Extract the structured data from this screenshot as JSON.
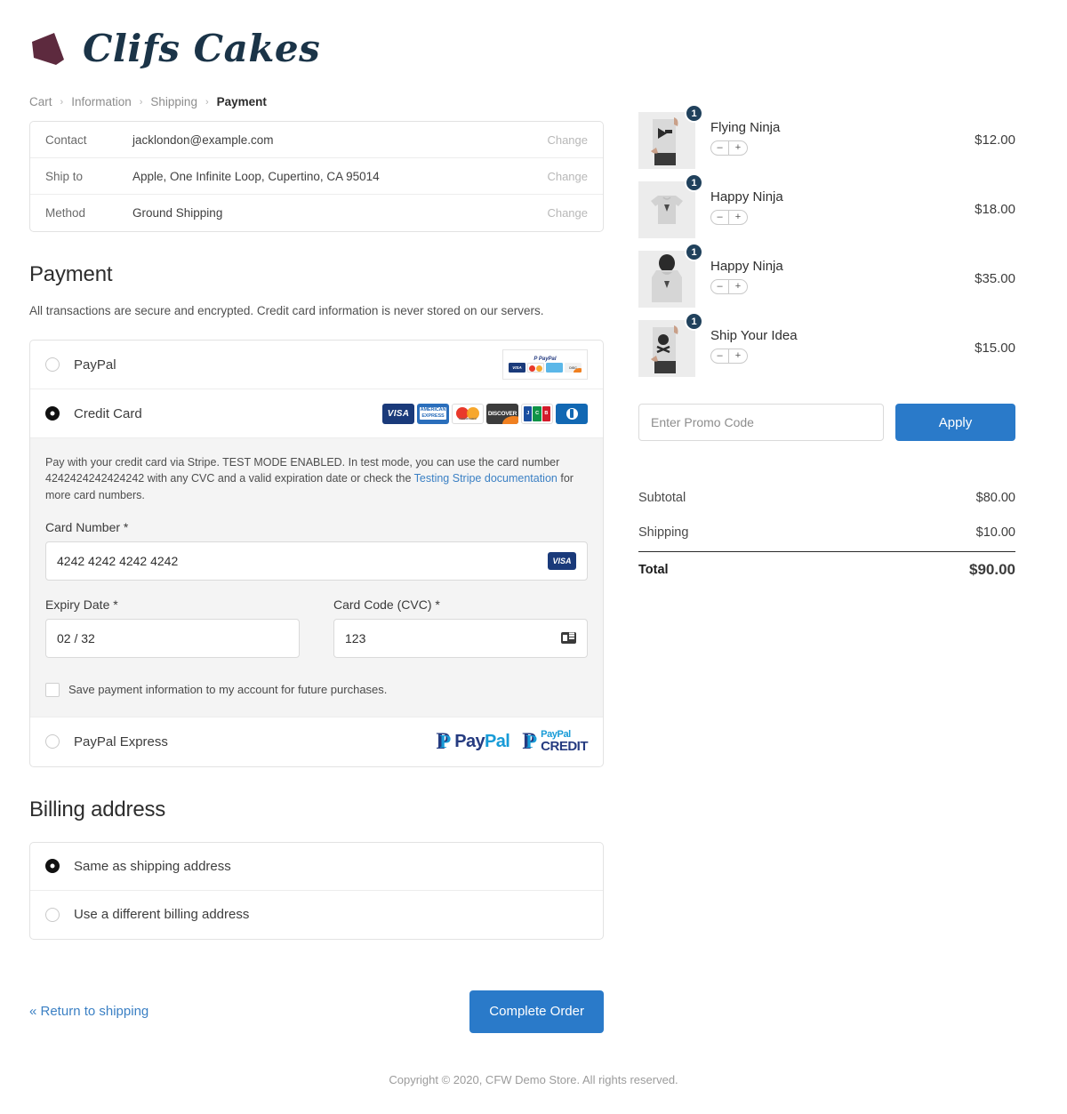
{
  "brand": {
    "name": "Clifs Cakes",
    "mark_color": "#5d2a3e",
    "text_color": "#1b3448"
  },
  "breadcrumb": [
    {
      "label": "Cart",
      "current": false
    },
    {
      "label": "Information",
      "current": false
    },
    {
      "label": "Shipping",
      "current": false
    },
    {
      "label": "Payment",
      "current": true
    }
  ],
  "breadcrumb_separator": "›",
  "summary": {
    "rows": [
      {
        "label": "Contact",
        "value": "jacklondon@example.com",
        "action": "Change"
      },
      {
        "label": "Ship to",
        "value": "Apple, One Infinite Loop, Cupertino, CA 95014",
        "action": "Change"
      },
      {
        "label": "Method",
        "value": "Ground Shipping",
        "action": "Change"
      }
    ]
  },
  "payment": {
    "title": "Payment",
    "description": "All transactions are secure and encrypted. Credit card information is never stored on our servers.",
    "methods": [
      {
        "label": "PayPal",
        "selected": false
      },
      {
        "label": "Credit Card",
        "selected": true
      },
      {
        "label": "PayPal Express",
        "selected": false
      }
    ],
    "card_brands": [
      "VISA",
      "AMERICAN EXPRESS",
      "mastercard",
      "DISCOVER",
      "JCB",
      "Diners Club"
    ],
    "stripe_note_part1": "Pay with your credit card via Stripe. TEST MODE ENABLED. In test mode, you can use the card number 4242424242424242 with any CVC and a valid expiration date or check the ",
    "stripe_note_link": "Testing Stripe documentation",
    "stripe_note_part2": " for more card numbers.",
    "card_number_label": "Card Number *",
    "card_number_value": "4242 4242 4242 4242",
    "card_number_brand": "VISA",
    "expiry_label": "Expiry Date *",
    "expiry_value": "02 / 32",
    "cvc_label": "Card Code (CVC) *",
    "cvc_value": "123",
    "save_label": "Save payment information to my account for future purchases.",
    "save_checked": false
  },
  "billing": {
    "title": "Billing address",
    "options": [
      {
        "label": "Same as shipping address",
        "selected": true
      },
      {
        "label": "Use a different billing address",
        "selected": false
      }
    ]
  },
  "actions": {
    "return_label": "« Return to shipping",
    "complete_label": "Complete Order",
    "primary_color": "#2a7ac9"
  },
  "cart": {
    "items": [
      {
        "name": "Flying Ninja",
        "qty": "1",
        "price": "$12.00",
        "art": "tee-flying"
      },
      {
        "name": "Happy Ninja",
        "qty": "1",
        "price": "$18.00",
        "art": "tee-flat"
      },
      {
        "name": "Happy Ninja",
        "qty": "1",
        "price": "$35.00",
        "art": "hoodie"
      },
      {
        "name": "Ship Your Idea",
        "qty": "1",
        "price": "$15.00",
        "art": "tee-skull"
      }
    ],
    "stepper": {
      "decrement": "–",
      "increment": "+"
    },
    "promo_placeholder": "Enter Promo Code",
    "promo_value": "",
    "apply_label": "Apply",
    "totals": [
      {
        "label": "Subtotal",
        "value": "$80.00",
        "grand": false
      },
      {
        "label": "Shipping",
        "value": "$10.00",
        "grand": false
      },
      {
        "label": "Total",
        "value": "$90.00",
        "grand": true
      }
    ]
  },
  "footer": {
    "text": "Copyright © 2020, CFW Demo Store. All rights reserved."
  }
}
